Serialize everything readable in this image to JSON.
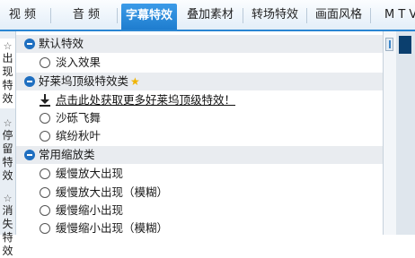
{
  "tabs": [
    {
      "label": "视 频"
    },
    {
      "label": "音 频"
    },
    {
      "label": "字幕特效"
    },
    {
      "label": "叠加素材"
    },
    {
      "label": "转场特效"
    },
    {
      "label": "画面风格"
    },
    {
      "label": "M T V"
    }
  ],
  "active_tab": "字幕特效",
  "side_tabs": [
    {
      "label": "出现特效",
      "icon": "star-outline-icon"
    },
    {
      "label": "停留特效",
      "icon": "star-outline-icon"
    },
    {
      "label": "消失特效",
      "icon": "star-outline-icon"
    }
  ],
  "active_side_tab": "出现特效",
  "groups": [
    {
      "label": "默认特效"
    },
    {
      "label": "好莱坞顶级特效类"
    },
    {
      "label": "常用缩放类"
    }
  ],
  "items": [
    {
      "label": "淡入效果"
    },
    {
      "label": "点击此处获取更多好莱坞顶级特效！"
    },
    {
      "label": "沙砾飞舞"
    },
    {
      "label": "缤纷秋叶"
    },
    {
      "label": "缓慢放大出现"
    },
    {
      "label": "缓慢放大出现（模糊）"
    },
    {
      "label": "缓慢缩小出现"
    },
    {
      "label": "缓慢缩小出现（模糊）"
    }
  ],
  "colors": {
    "accent": "#2a86d3",
    "group_bg": "#e9ecf0",
    "minus_icon": "#1f6fc0",
    "star": "#f0b400"
  }
}
